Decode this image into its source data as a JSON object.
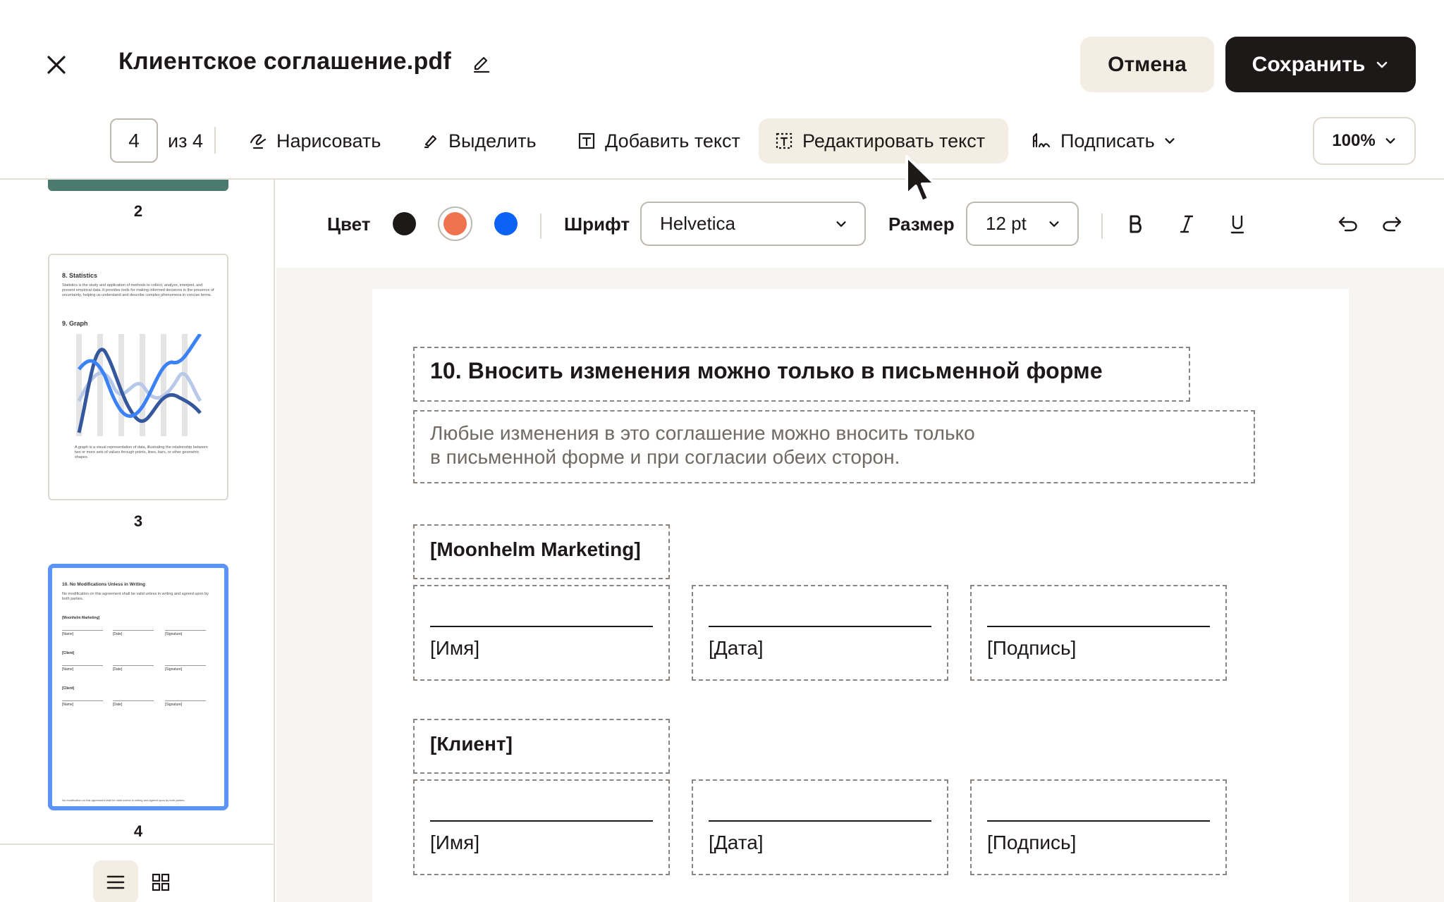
{
  "header": {
    "title": "Клиентское соглашение.pdf",
    "cancel_label": "Отмена",
    "save_label": "Сохранить"
  },
  "toolbar": {
    "page_current": "4",
    "page_of": "из 4",
    "draw_label": "Нарисовать",
    "highlight_label": "Выделить",
    "add_text_label": "Добавить текст",
    "edit_text_label": "Редактировать текст",
    "sign_label": "Подписать",
    "zoom": "100%"
  },
  "format_bar": {
    "color_label": "Цвет",
    "colors": [
      "#1e1919",
      "#f07350",
      "#0b62f5"
    ],
    "selected_color_index": 1,
    "font_label": "Шрифт",
    "font_value": "Helvetica",
    "size_label": "Размер",
    "size_value": "12 pt"
  },
  "sidebar": {
    "thumbnails": [
      {
        "number": "2"
      },
      {
        "number": "3",
        "heading1": "8. Statistics",
        "para1": "Statistics is the study and application of methods to collect, analyze, interpret, and present empirical data. It provides tools for making informed decisions in the presence of uncertainty, helping us understand and describe complex phenomena in concise terms.",
        "heading2": "9. Graph",
        "para2": "A graph is a visual representation of data, illustrating the relationship between two or more sets of values through points, lines, bars, or other geometric shapes."
      },
      {
        "number": "4",
        "heading": "10. No Modifications Unless in Writing",
        "para": "No modification on this agreement shall be valid unless in writing and agreed upon by both parties.",
        "party1": "[Moonhelm Marketing]",
        "party2": "[Client]",
        "party3": "[Client]",
        "name": "[Name]",
        "date": "[Date]",
        "signature": "[Signature]",
        "footer": "No modification on this agreement shall be valid unless in writing and agreed upon by both parties."
      }
    ]
  },
  "document": {
    "heading": "10. Вносить изменения можно только в письменной форме",
    "body_line1": "Любые изменения в это соглашение можно вносить только",
    "body_line2": "в письменной форме и при согласии обеих сторон.",
    "party1": "[Moonhelm Marketing]",
    "party2": "[Клиент]",
    "name_label": "[Имя]",
    "date_label": "[Дата]",
    "signature_label": "[Подпись]"
  }
}
